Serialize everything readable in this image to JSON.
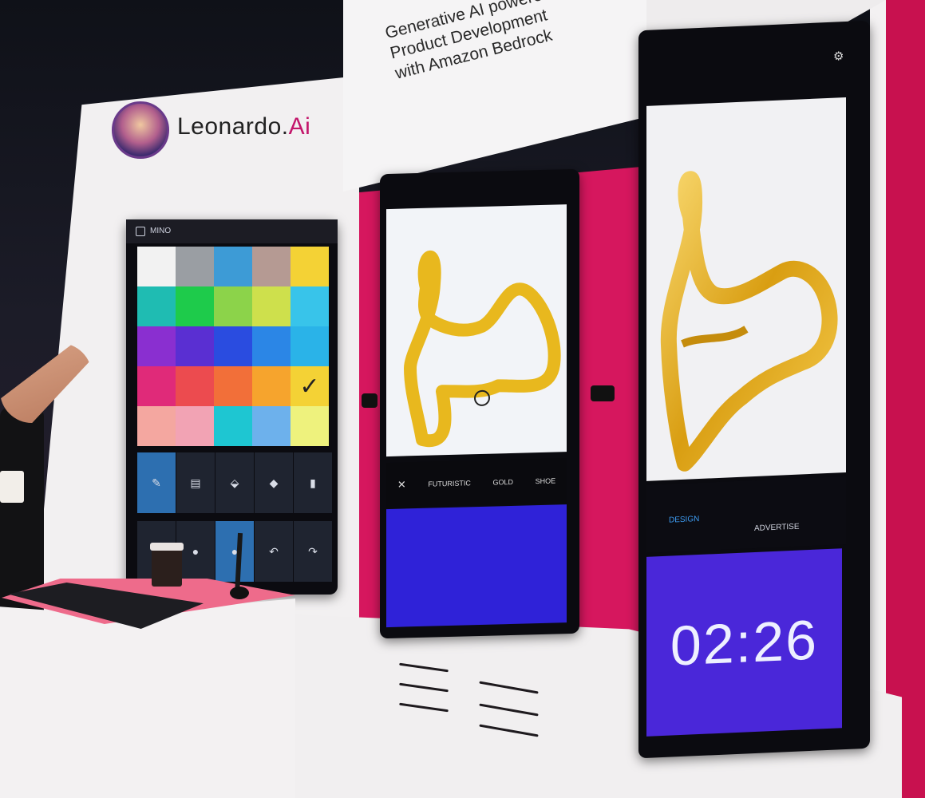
{
  "booth": {
    "brand": {
      "name_main": "Leonardo.",
      "name_accent": "Ai",
      "logo_icon": "leonardo-portrait-logo-icon",
      "accent_color": "#c3166b"
    },
    "banner_lines": [
      "Generative AI powered",
      "Product Development",
      "with Amazon Bedrock"
    ],
    "wall_color": "#d6175e"
  },
  "screen_left": {
    "header_icon": "app-icon",
    "header_label": "MINO",
    "palette": [
      [
        "#f2f2f2",
        "#9a9ea3",
        "#3d9bd6",
        "#b59a93",
        ""
      ],
      [
        "#1fbcb2",
        "#1ecb4b",
        "#8cd34a",
        "#cee04c",
        "#38c4ea"
      ],
      [
        "#8a2fd0",
        "#5a2fd2",
        "#2a4ce0",
        "#2b86e6",
        "#2ab3e8"
      ],
      [
        "#e02a79",
        "#ec4b4f",
        "#f26f39",
        "#f6a42d",
        "#f4d235"
      ],
      [
        "#f4a7a0",
        "#f2a3b4",
        "#1ec6d2",
        "#6db1ec",
        "#eef27d"
      ]
    ],
    "selected_swatch_icon": "checkmark-icon",
    "tools_row1": [
      {
        "icon": "pencil-icon",
        "symbol": "✎",
        "active": true
      },
      {
        "icon": "stamp-icon",
        "symbol": "▤",
        "active": false
      },
      {
        "icon": "fill-bucket-icon",
        "symbol": "⬙",
        "active": false
      },
      {
        "icon": "eraser-icon",
        "symbol": "◆",
        "active": false
      },
      {
        "icon": "trash-icon",
        "symbol": "▮",
        "active": false
      }
    ],
    "tools_row2": [
      {
        "icon": "small-brush-icon",
        "symbol": "•",
        "active": false
      },
      {
        "icon": "medium-brush-icon",
        "symbol": "●",
        "active": false
      },
      {
        "icon": "large-brush-icon",
        "symbol": "●",
        "active": true
      },
      {
        "icon": "undo-icon",
        "symbol": "↶",
        "active": false
      },
      {
        "icon": "redo-icon",
        "symbol": "↷",
        "active": false
      }
    ]
  },
  "screen_middle": {
    "sketch_color": "#e8b81e",
    "prompt_icon": "shuffle-icon",
    "prompt_tags": [
      "FUTURISTIC",
      "GOLD",
      "SHOE"
    ],
    "panel_color": "#2f22d8"
  },
  "screen_right": {
    "settings_icon": "gear-icon",
    "tabs": [
      "DESIGN",
      "ADVERTISE"
    ],
    "timer": "02:26",
    "timer_color": "#4a27d9"
  }
}
